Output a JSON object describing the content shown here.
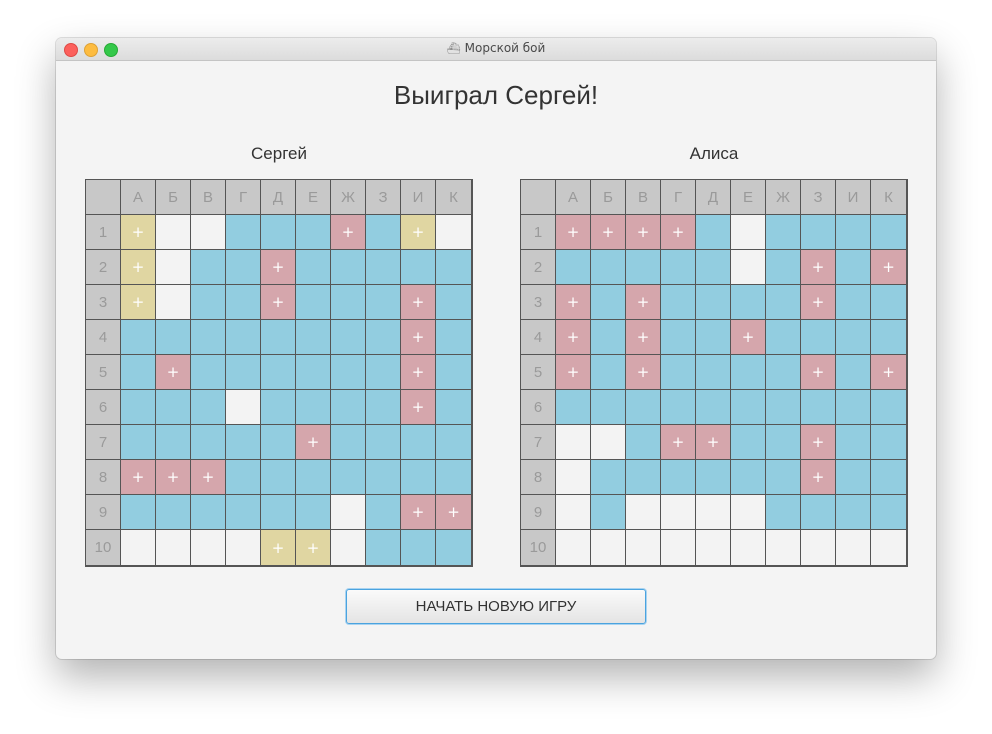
{
  "window": {
    "title": "Морской бой",
    "title_icon": "ship-icon"
  },
  "headline": "Выиграл Сергей!",
  "columns": [
    "А",
    "Б",
    "В",
    "Г",
    "Д",
    "Е",
    "Ж",
    "З",
    "И",
    "К"
  ],
  "rows": [
    "1",
    "2",
    "3",
    "4",
    "5",
    "6",
    "7",
    "8",
    "9",
    "10"
  ],
  "mark_symbol": "+",
  "colors": {
    "w": "#f3f3f3",
    "b": "#92cde0",
    "r": "#d5a6ac",
    "y": "#e0d6a2",
    "header": "#c8c8c8"
  },
  "legend": {
    "w": "empty / not shot",
    "b": "miss (water)",
    "r": "hit ship",
    "y": "surviving ship"
  },
  "boards": [
    {
      "name": "Сергей",
      "grid": [
        [
          "y",
          "w",
          "w",
          "b",
          "b",
          "b",
          "r",
          "b",
          "y",
          "w"
        ],
        [
          "y",
          "w",
          "b",
          "b",
          "r",
          "b",
          "b",
          "b",
          "b",
          "b"
        ],
        [
          "y",
          "w",
          "b",
          "b",
          "r",
          "b",
          "b",
          "b",
          "r",
          "b"
        ],
        [
          "b",
          "b",
          "b",
          "b",
          "b",
          "b",
          "b",
          "b",
          "r",
          "b"
        ],
        [
          "b",
          "r",
          "b",
          "b",
          "b",
          "b",
          "b",
          "b",
          "r",
          "b"
        ],
        [
          "b",
          "b",
          "b",
          "w",
          "b",
          "b",
          "b",
          "b",
          "r",
          "b"
        ],
        [
          "b",
          "b",
          "b",
          "b",
          "b",
          "r",
          "b",
          "b",
          "b",
          "b"
        ],
        [
          "r",
          "r",
          "r",
          "b",
          "b",
          "b",
          "b",
          "b",
          "b",
          "b"
        ],
        [
          "b",
          "b",
          "b",
          "b",
          "b",
          "b",
          "w",
          "b",
          "r",
          "r"
        ],
        [
          "w",
          "w",
          "w",
          "w",
          "y",
          "y",
          "w",
          "b",
          "b",
          "b"
        ]
      ]
    },
    {
      "name": "Алиса",
      "grid": [
        [
          "r",
          "r",
          "r",
          "r",
          "b",
          "w",
          "b",
          "b",
          "b",
          "b"
        ],
        [
          "b",
          "b",
          "b",
          "b",
          "b",
          "w",
          "b",
          "r",
          "b",
          "r"
        ],
        [
          "r",
          "b",
          "r",
          "b",
          "b",
          "b",
          "b",
          "r",
          "b",
          "b"
        ],
        [
          "r",
          "b",
          "r",
          "b",
          "b",
          "r",
          "b",
          "b",
          "b",
          "b"
        ],
        [
          "r",
          "b",
          "r",
          "b",
          "b",
          "b",
          "b",
          "r",
          "b",
          "r"
        ],
        [
          "b",
          "b",
          "b",
          "b",
          "b",
          "b",
          "b",
          "b",
          "b",
          "b"
        ],
        [
          "w",
          "w",
          "b",
          "r",
          "r",
          "b",
          "b",
          "r",
          "b",
          "b"
        ],
        [
          "w",
          "b",
          "b",
          "b",
          "b",
          "b",
          "b",
          "r",
          "b",
          "b"
        ],
        [
          "w",
          "b",
          "w",
          "w",
          "w",
          "w",
          "b",
          "b",
          "b",
          "b"
        ],
        [
          "w",
          "w",
          "w",
          "w",
          "w",
          "w",
          "w",
          "w",
          "w",
          "w"
        ]
      ]
    }
  ],
  "button": {
    "label": "НАЧАТЬ НОВУЮ ИГРУ"
  }
}
